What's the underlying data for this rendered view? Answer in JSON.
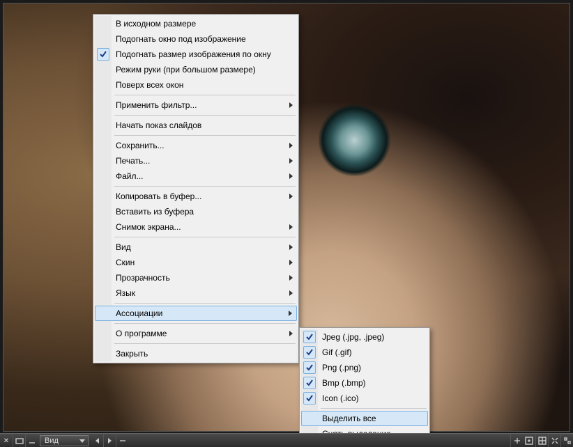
{
  "toolbar": {
    "close_label": "✕",
    "view_dropdown_label": "Вид"
  },
  "menu": {
    "items": [
      {
        "label": "В исходном размере"
      },
      {
        "label": "Подогнать окно под изображение"
      },
      {
        "label": "Подогнать размер изображения по окну",
        "checked": true
      },
      {
        "label": "Режим руки (при большом размере)"
      },
      {
        "label": "Поверх всех окон"
      },
      {
        "sep": true
      },
      {
        "label": "Применить фильтр...",
        "submenu": true
      },
      {
        "sep": true
      },
      {
        "label": "Начать показ слайдов"
      },
      {
        "sep": true
      },
      {
        "label": "Сохранить...",
        "submenu": true
      },
      {
        "label": "Печать...",
        "submenu": true
      },
      {
        "label": "Файл...",
        "submenu": true
      },
      {
        "sep": true
      },
      {
        "label": "Копировать в буфер...",
        "submenu": true
      },
      {
        "label": "Вставить из буфера"
      },
      {
        "label": "Снимок экрана...",
        "submenu": true
      },
      {
        "sep": true
      },
      {
        "label": "Вид",
        "submenu": true
      },
      {
        "label": "Скин",
        "submenu": true
      },
      {
        "label": "Прозрачность",
        "submenu": true
      },
      {
        "label": "Язык",
        "submenu": true
      },
      {
        "sep": true
      },
      {
        "label": "Ассоциации",
        "submenu": true,
        "highlight": true
      },
      {
        "sep": true
      },
      {
        "label": "О программе",
        "submenu": true
      },
      {
        "sep": true
      },
      {
        "label": "Закрыть"
      }
    ]
  },
  "submenu": {
    "items": [
      {
        "label": "Jpeg (.jpg, .jpeg)",
        "checked": true
      },
      {
        "label": "Gif (.gif)",
        "checked": true
      },
      {
        "label": "Png (.png)",
        "checked": true
      },
      {
        "label": "Bmp (.bmp)",
        "checked": true
      },
      {
        "label": "Icon (.ico)",
        "checked": true
      },
      {
        "sep": true
      },
      {
        "label": "Выделить все",
        "highlight": true
      },
      {
        "label": "Снять выделение"
      }
    ]
  }
}
